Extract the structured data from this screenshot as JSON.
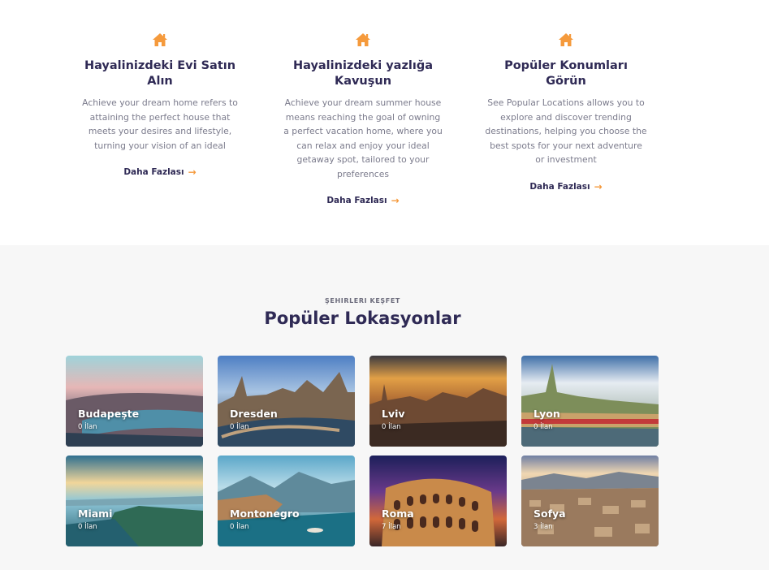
{
  "features": [
    {
      "icon": "house-icon",
      "title": "Hayalinizdeki Evi Satın Alın",
      "description": "Achieve your dream home refers to attaining the perfect house that meets your desires and lifestyle, turning your vision of an ideal",
      "link_label": "Daha Fazlası"
    },
    {
      "icon": "house-icon",
      "title": "Hayalinizdeki yazlığa Kavuşun",
      "description": "Achieve your dream summer house means reaching the goal of owning a perfect vacation home, where you can relax and enjoy your ideal getaway spot, tailored to your preferences",
      "link_label": "Daha Fazlası"
    },
    {
      "icon": "house-icon",
      "title": "Popüler Konumları Görün",
      "description": "See Popular Locations allows you to explore and discover trending destinations, helping you choose the best spots for your next adventure or investment",
      "link_label": "Daha Fazlası"
    }
  ],
  "colors": {
    "accent": "#f59a3c",
    "heading": "#2f2a55",
    "body_text": "#7b7b8c",
    "section_bg": "#f7f7f7"
  },
  "locations": {
    "eyebrow": "ŞEHIRLERI KEŞFET",
    "title": "Popüler Lokasyonlar",
    "cards": [
      {
        "city": "Budapeşte",
        "count": "0 İlan"
      },
      {
        "city": "Dresden",
        "count": "0 İlan"
      },
      {
        "city": "Lviv",
        "count": "0 İlan"
      },
      {
        "city": "Lyon",
        "count": "0 İlan"
      },
      {
        "city": "Miami",
        "count": "0 İlan"
      },
      {
        "city": "Montonegro",
        "count": "0 İlan"
      },
      {
        "city": "Roma",
        "count": "7 İlan"
      },
      {
        "city": "Sofya",
        "count": "3 İlan"
      }
    ]
  }
}
